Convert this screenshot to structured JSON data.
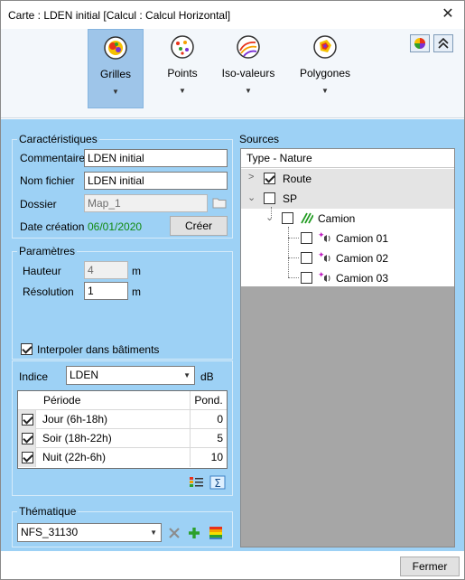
{
  "window": {
    "title": "Carte : LDEN initial [Calcul : Calcul Horizontal]"
  },
  "ribbon": {
    "buttons": [
      {
        "label": "Grilles",
        "active": true
      },
      {
        "label": "Points",
        "active": false
      },
      {
        "label": "Iso-valeurs",
        "active": false
      },
      {
        "label": "Polygones",
        "active": false
      }
    ]
  },
  "caracteristiques": {
    "title": "Caractéristiques",
    "commentaire_label": "Commentaire",
    "commentaire_value": "LDEN initial",
    "nom_fichier_label": "Nom fichier",
    "nom_fichier_value": "LDEN initial",
    "dossier_label": "Dossier",
    "dossier_value": "Map_1",
    "date_label": "Date création",
    "date_value": "06/01/2020",
    "creer_label": "Créer"
  },
  "parametres": {
    "title": "Paramètres",
    "hauteur_label": "Hauteur",
    "hauteur_value": "4",
    "hauteur_unit": "m",
    "resolution_label": "Résolution",
    "resolution_value": "1",
    "resolution_unit": "m",
    "interpoler_label": "Interpoler dans bâtiments",
    "interpoler_checked": true
  },
  "indice": {
    "label": "Indice",
    "value": "LDEN",
    "unit": "dB",
    "table": {
      "col_periode": "Période",
      "col_pond": "Pond.",
      "rows": [
        {
          "periode": "Jour (6h-18h)",
          "pond": "0",
          "checked": true
        },
        {
          "periode": "Soir (18h-22h)",
          "pond": "5",
          "checked": true
        },
        {
          "periode": "Nuit (22h-6h)",
          "pond": "10",
          "checked": true
        }
      ]
    }
  },
  "thematique": {
    "title": "Thématique",
    "value": "NFS_31130"
  },
  "sources": {
    "title": "Sources",
    "header": "Type - Nature",
    "items": [
      {
        "label": "Route",
        "checked": true,
        "expanded": false
      },
      {
        "label": "SP",
        "checked": false,
        "expanded": true
      },
      {
        "label": "Camion",
        "checked": false,
        "expanded": true
      },
      {
        "label": "Camion 01",
        "checked": false
      },
      {
        "label": "Camion 02",
        "checked": false
      },
      {
        "label": "Camion 03",
        "checked": false
      }
    ]
  },
  "footer": {
    "fermer_label": "Fermer"
  },
  "colors": {
    "panel_bg": "#9dd1f5",
    "active_ribbon": "#9ec5e9",
    "date_green": "#118a11"
  }
}
